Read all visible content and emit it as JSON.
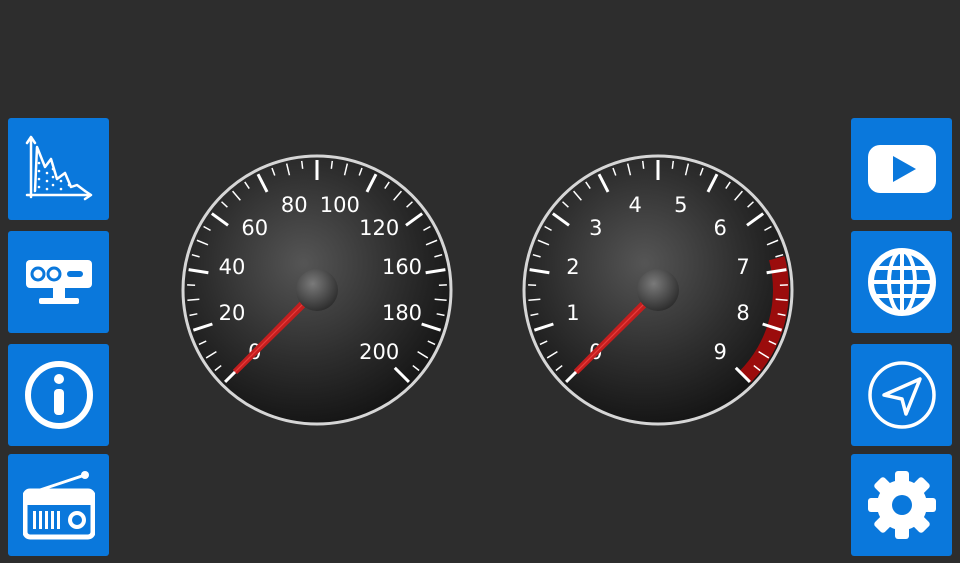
{
  "left_buttons": [
    {
      "icon": "chart-icon"
    },
    {
      "icon": "camera-sensor-icon"
    },
    {
      "icon": "info-icon"
    },
    {
      "icon": "radio-icon"
    }
  ],
  "right_buttons": [
    {
      "icon": "play-icon"
    },
    {
      "icon": "globe-icon"
    },
    {
      "icon": "navigation-icon"
    },
    {
      "icon": "gear-icon"
    }
  ],
  "speedometer": {
    "labels": [
      "0",
      "20",
      "40",
      "60",
      "80",
      "100",
      "120",
      "160",
      "180",
      "200"
    ],
    "value": 0
  },
  "tachometer": {
    "labels": [
      "0",
      "1",
      "2",
      "3",
      "4",
      "5",
      "6",
      "7",
      "8",
      "9"
    ],
    "value": 0,
    "redline_from": 7,
    "redline_color": "#9b0c0c"
  },
  "colors": {
    "background": "#2d2d2d",
    "button": "#0a78dc",
    "needle": "#c41e1e"
  }
}
